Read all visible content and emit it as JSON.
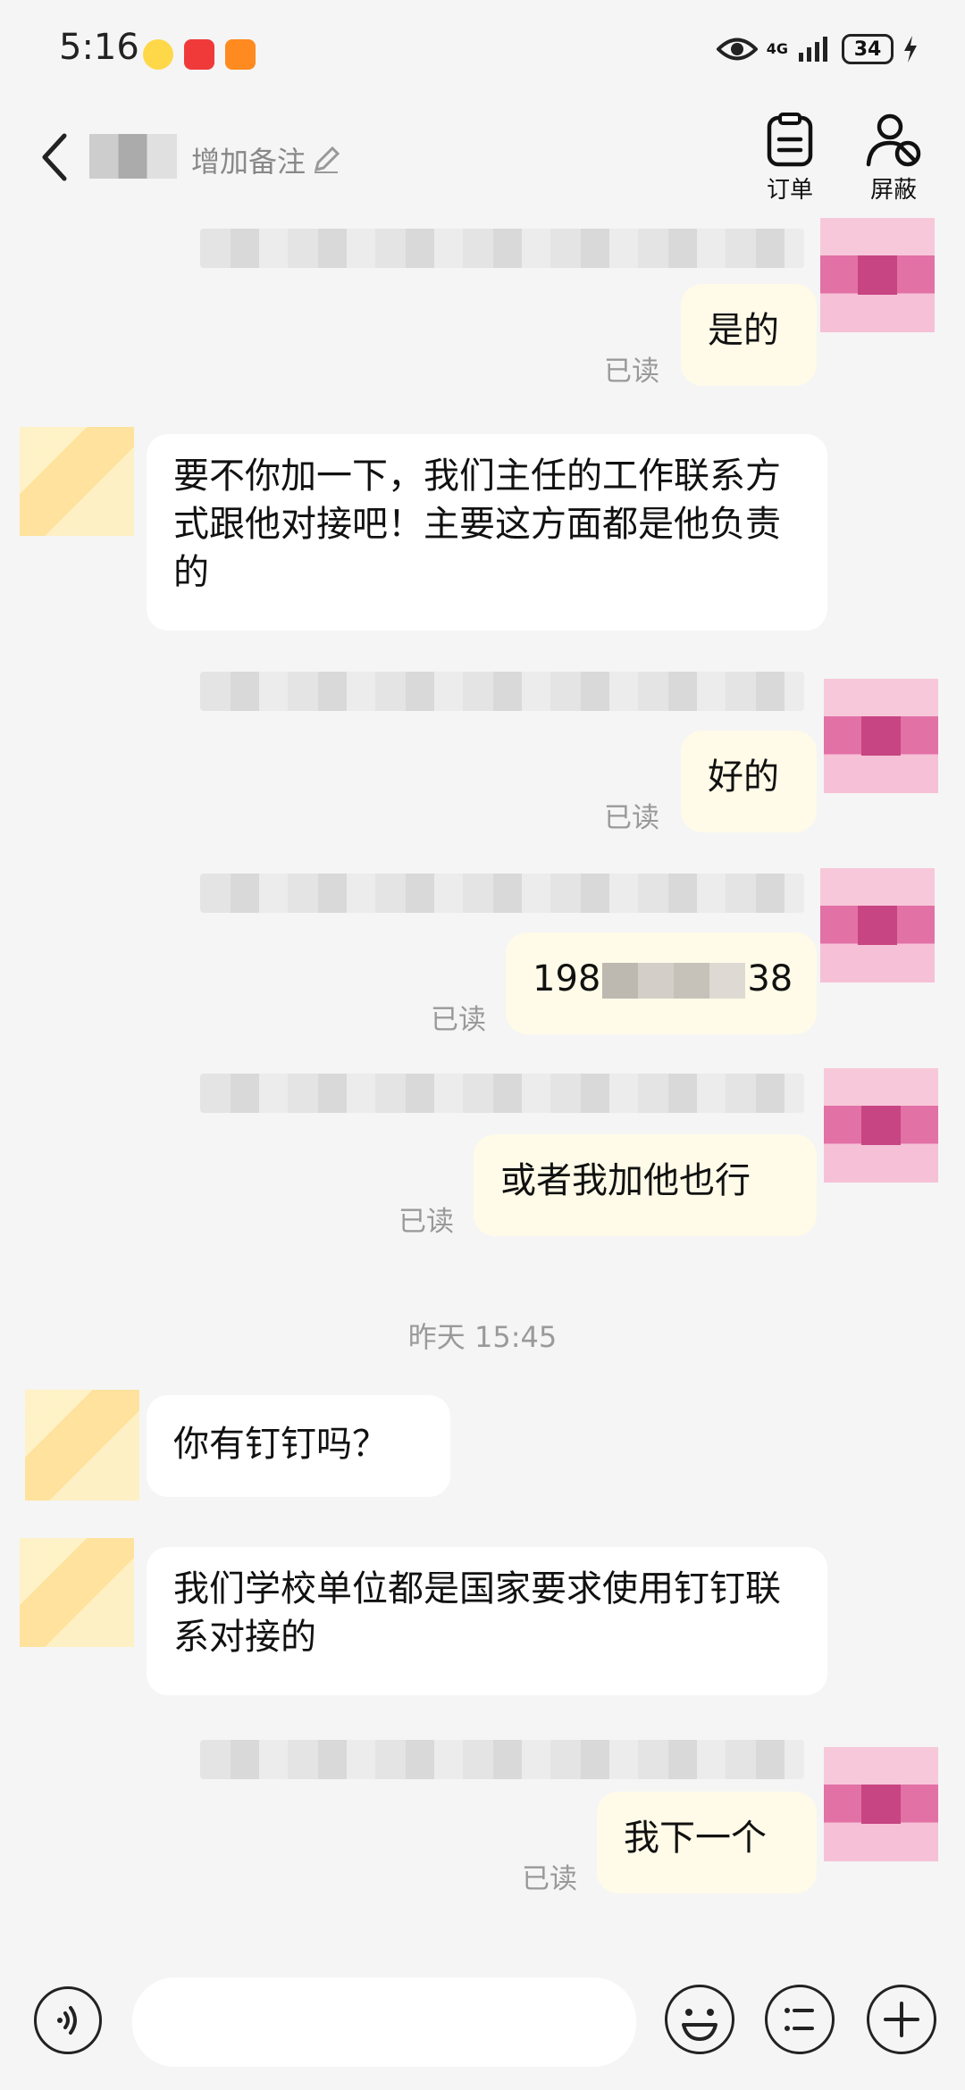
{
  "status_bar": {
    "time": "5:16",
    "network": "4G",
    "battery": "34"
  },
  "header": {
    "remark_label": "增加备注",
    "order_label": "订单",
    "block_label": "屏蔽"
  },
  "messages": {
    "m1": {
      "text": "是的",
      "status": "已读"
    },
    "m2": {
      "text": "要不你加一下，我们主任的工作联系方式跟他对接吧！主要这方面都是他负责的"
    },
    "m3": {
      "text": "好的",
      "status": "已读"
    },
    "m4": {
      "prefix": "198",
      "suffix": "38",
      "status": "已读"
    },
    "m5": {
      "text": "或者我加他也行",
      "status": "已读"
    },
    "divider": "昨天 15:45",
    "m6": {
      "text": "你有钉钉吗？"
    },
    "m7": {
      "text": "我们学校单位都是国家要求使用钉钉联系对接的"
    },
    "m8": {
      "text": "我下一个",
      "status": "已读"
    }
  },
  "input": {
    "placeholder": ""
  }
}
